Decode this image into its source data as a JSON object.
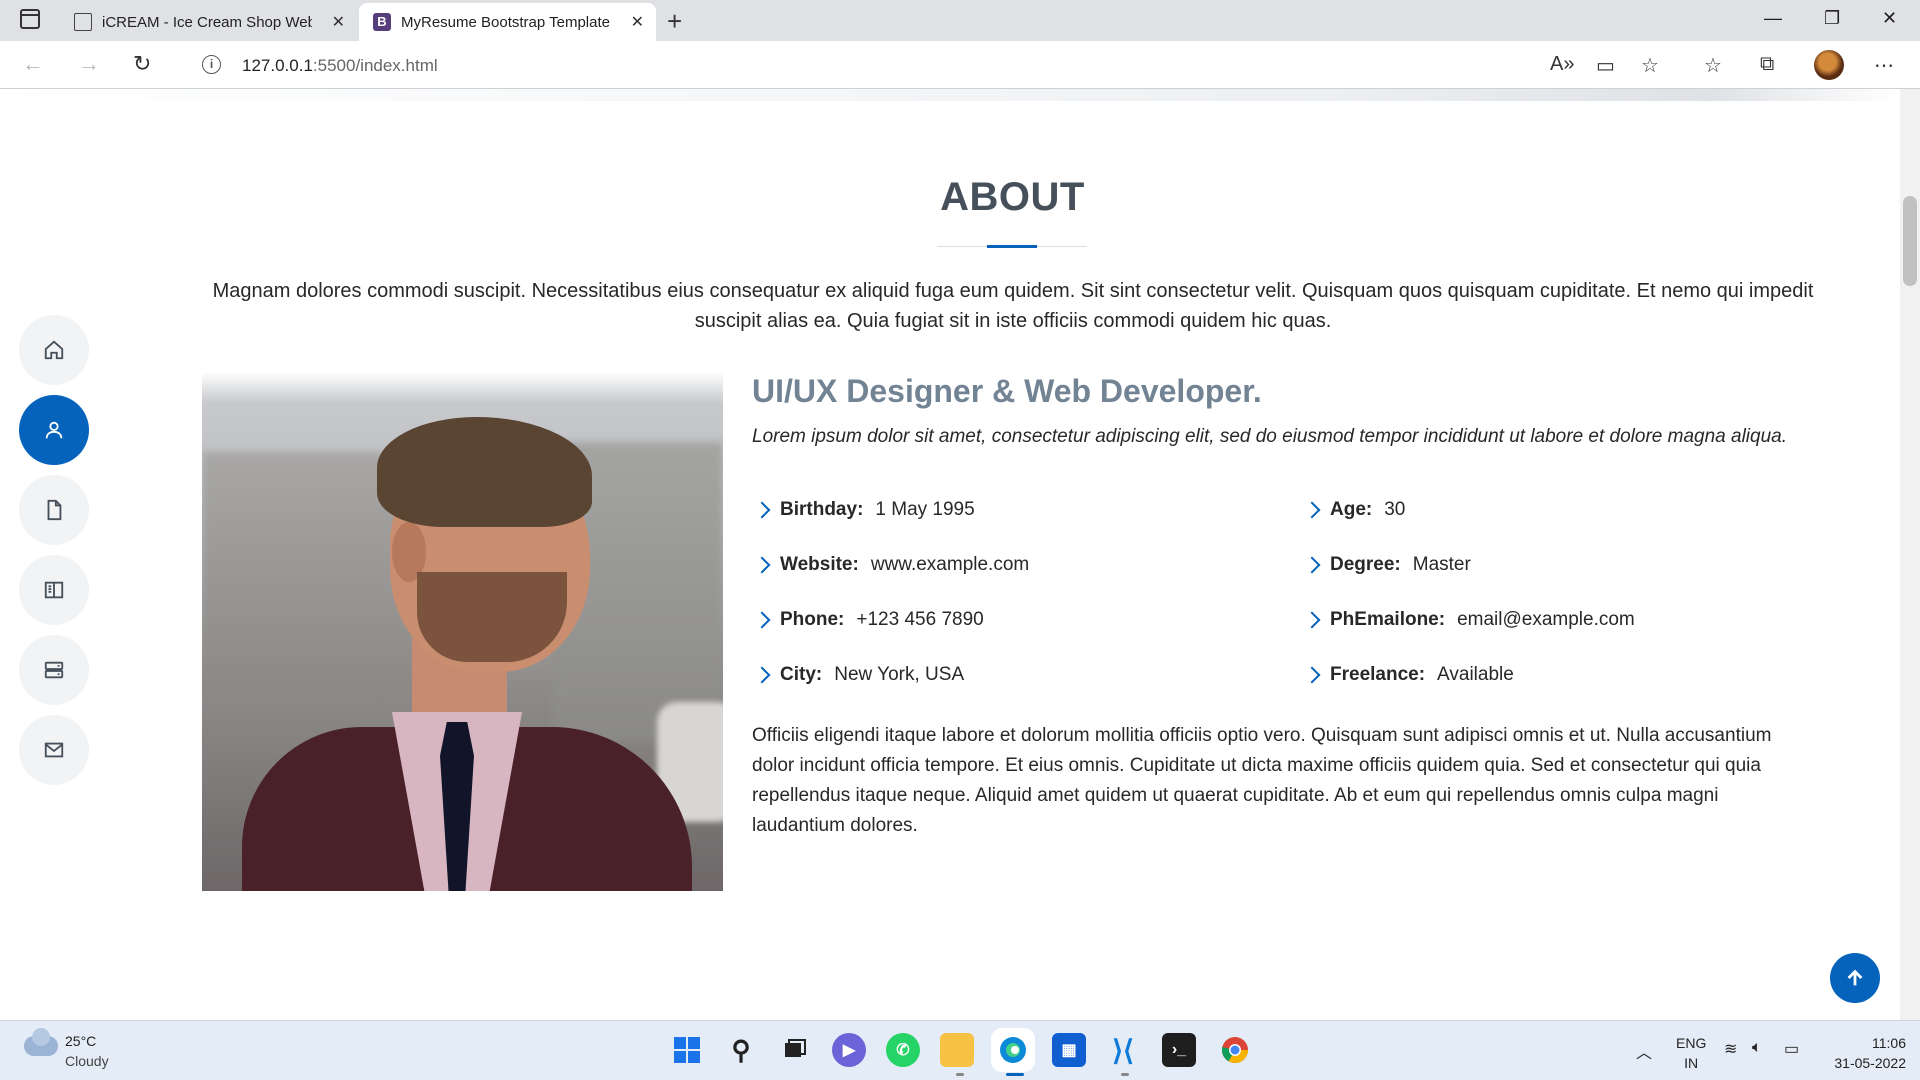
{
  "browser": {
    "tabs": [
      {
        "title": "iCREAM - Ice Cream Shop Website",
        "icon": "document-icon",
        "active": false
      },
      {
        "title": "MyResume Bootstrap Template -",
        "icon": "bootstrap-icon",
        "active": true
      }
    ],
    "url_host": "127.0.0.1",
    "url_rest": ":5500/index.html"
  },
  "about": {
    "title": "ABOUT",
    "intro": "Magnam dolores commodi suscipit. Necessitatibus eius consequatur ex aliquid fuga eum quidem. Sit sint consectetur velit. Quisquam quos quisquam cupiditate. Et nemo qui impedit suscipit alias ea. Quia fugiat sit in iste officiis commodi quidem hic quas.",
    "subtitle": "UI/UX Designer & Web Developer.",
    "lead": "Lorem ipsum dolor sit amet, consectetur adipiscing elit, sed do eiusmod tempor incididunt ut labore et dolore magna aliqua.",
    "facts": [
      {
        "label": "Birthday:",
        "value": "1 May 1995"
      },
      {
        "label": "Age:",
        "value": "30"
      },
      {
        "label": "Website:",
        "value": "www.example.com"
      },
      {
        "label": "Degree:",
        "value": "Master"
      },
      {
        "label": "Phone:",
        "value": "+123 456 7890"
      },
      {
        "label": "PhEmailone:",
        "value": "email@example.com"
      },
      {
        "label": "City:",
        "value": "New York, USA"
      },
      {
        "label": "Freelance:",
        "value": "Available"
      }
    ],
    "body": "Officiis eligendi itaque labore et dolorum mollitia officiis optio vero. Quisquam sunt adipisci omnis et ut. Nulla accusantium dolor incidunt officia tempore. Et eius omnis. Cupiditate ut dicta maxime officiis quidem quia. Sed et consectetur qui quia repellendus itaque neque. Aliquid amet quidem ut quaerat cupiditate. Ab et eum qui repellendus omnis culpa magni laudantium dolores."
  },
  "sidenav": [
    {
      "icon": "home-icon",
      "active": false
    },
    {
      "icon": "person-icon",
      "active": true
    },
    {
      "icon": "file-icon",
      "active": false
    },
    {
      "icon": "book-icon",
      "active": false
    },
    {
      "icon": "server-icon",
      "active": false
    },
    {
      "icon": "envelope-icon",
      "active": false
    }
  ],
  "taskbar": {
    "temperature": "25°C",
    "condition": "Cloudy",
    "lang_top": "ENG",
    "lang_bottom": "IN",
    "time": "11:06",
    "date": "31-05-2022"
  },
  "colors": {
    "accent": "#0563bb",
    "heading": "#45505b",
    "subtitle": "#728394"
  }
}
